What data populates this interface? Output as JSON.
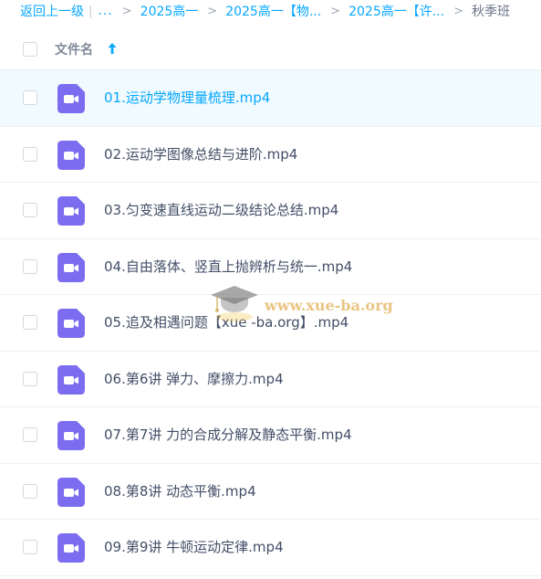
{
  "breadcrumb": {
    "back_label": "返回上一级",
    "divider": "|",
    "ellipsis": "...",
    "separator": ">",
    "items": [
      "2025高一",
      "2025高一【物...",
      "2025高一【许..."
    ],
    "current": "秋季班"
  },
  "header": {
    "name_label": "文件名",
    "sort_icon": "arrow-up-icon"
  },
  "files": [
    {
      "name": "01.运动学物理量梳理.mp4",
      "icon": "video-file-icon",
      "active": true
    },
    {
      "name": "02.运动学图像总结与进阶.mp4",
      "icon": "video-file-icon"
    },
    {
      "name": "03.匀变速直线运动二级结论总结.mp4",
      "icon": "video-file-icon"
    },
    {
      "name": "04.自由落体、竖直上抛辨析与统一.mp4",
      "icon": "video-file-icon"
    },
    {
      "name": "05.追及相遇问题【xue -ba.org】.mp4",
      "icon": "video-file-icon"
    },
    {
      "name": "06.第6讲 弹力、摩擦力.mp4",
      "icon": "video-file-icon"
    },
    {
      "name": "07.第7讲 力的合成分解及静态平衡.mp4",
      "icon": "video-file-icon"
    },
    {
      "name": "08.第8讲 动态平衡.mp4",
      "icon": "video-file-icon"
    },
    {
      "name": "09.第9讲 牛顿运动定律.mp4",
      "icon": "video-file-icon"
    }
  ],
  "watermark": {
    "text": "www.xue-ba.org",
    "icon": "graduation-cap-icon"
  },
  "colors": {
    "accent": "#06a7ff",
    "video_icon": "#7b6cf0",
    "active_row_bg": "#f0faff",
    "text": "#424e67"
  }
}
